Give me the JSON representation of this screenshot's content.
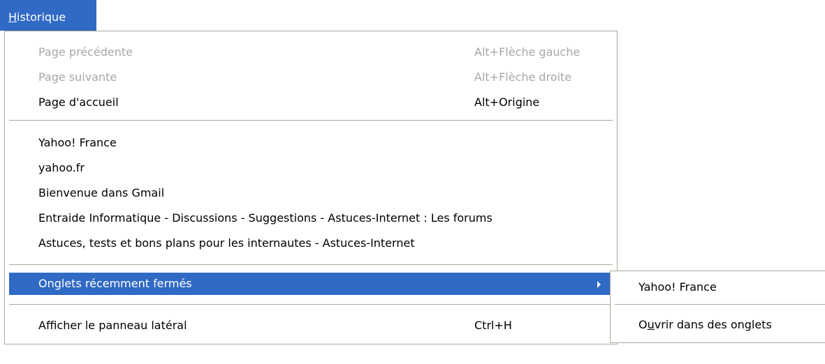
{
  "menubar": {
    "title_prefix": "H",
    "title_rest": "istorique"
  },
  "menu": {
    "navigation": [
      {
        "label": "Page précédente",
        "accel": "Alt+Flèche gauche",
        "enabled": false
      },
      {
        "label": "Page suivante",
        "accel": "Alt+Flèche droite",
        "enabled": false
      },
      {
        "label": "Page d'accueil",
        "accel": "Alt+Origine",
        "enabled": true
      }
    ],
    "history": [
      {
        "label": "Yahoo! France"
      },
      {
        "label": "yahoo.fr"
      },
      {
        "label": "Bienvenue dans Gmail"
      },
      {
        "label": "Entraide Informatique - Discussions - Suggestions - Astuces-Internet : Les forums"
      },
      {
        "label": "Astuces, tests et bons plans pour les internautes - Astuces-Internet"
      }
    ],
    "recently_closed": {
      "label": "Onglets récemment fermés"
    },
    "sidebar": {
      "label": "Afficher le panneau latéral",
      "accel": "Ctrl+H"
    }
  },
  "submenu": {
    "items": [
      {
        "label": "Yahoo! France"
      }
    ],
    "open_all": {
      "prefix": "O",
      "underlined": "u",
      "rest": "vrir dans des onglets"
    }
  },
  "colors": {
    "highlight": "#316ac5",
    "disabled_text": "#a7a7a7",
    "separator": "#aca899"
  }
}
